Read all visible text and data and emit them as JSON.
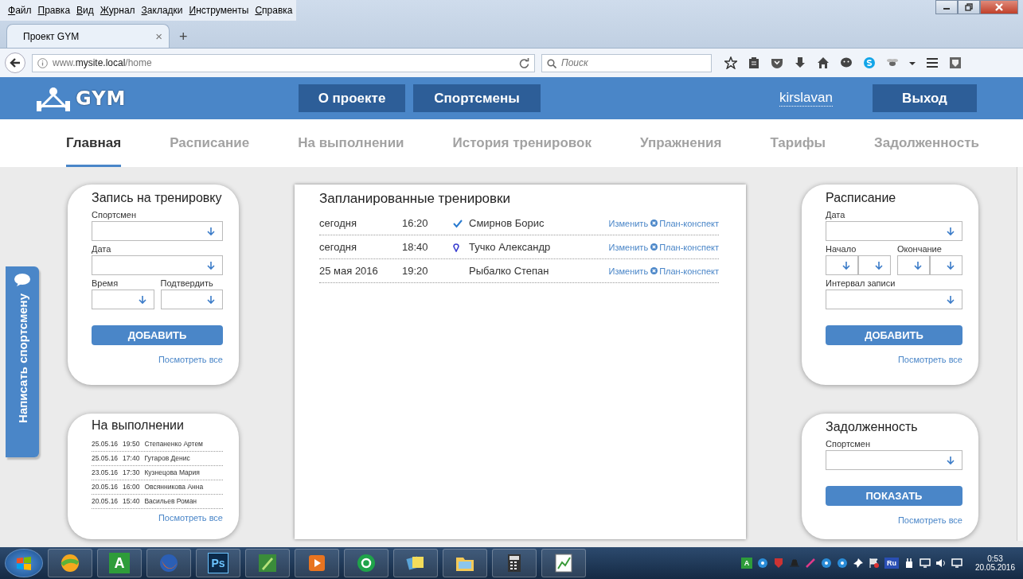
{
  "browser": {
    "menu": [
      "Файл",
      "Правка",
      "Вид",
      "Журнал",
      "Закладки",
      "Инструменты",
      "Справка"
    ],
    "tab": {
      "title": "Проект GYM",
      "close": "×"
    },
    "new_tab": "+",
    "url": "www.**mysite.local**/home",
    "search": {
      "placeholder": "Поиск"
    }
  },
  "header": {
    "logo": "GYM",
    "buttons": [
      "О проекте",
      "Спортсмены"
    ],
    "user": "kirslavan",
    "logout": "Выход"
  },
  "nav": [
    {
      "label": "Главная",
      "selected": true
    },
    {
      "label": "Расписание",
      "selected": false
    },
    {
      "label": "На выполнении",
      "selected": false
    },
    {
      "label": "История тренировок",
      "selected": false
    },
    {
      "label": "Упражнения",
      "selected": false
    },
    {
      "label": "Тарифы",
      "selected": false
    },
    {
      "label": "Задолженность",
      "selected": false
    }
  ],
  "side_tab": {
    "label": "Написать спортсмену"
  },
  "booking": {
    "title": "Запись на тренировку",
    "fields": [
      {
        "kind": "select",
        "label": "Спортсмен"
      },
      {
        "kind": "select",
        "label": "Дата"
      },
      {
        "kind": "half",
        "label": "Время"
      },
      {
        "kind": "half",
        "label": "Подтвердить"
      }
    ],
    "button": "ДОБАВИТЬ",
    "link": "Посмотреть все"
  },
  "in_progress": {
    "title": "На выполнении",
    "rows": [
      {
        "date": "25.05.16",
        "time": "19:50",
        "name": "Степаненко Артем"
      },
      {
        "date": "25.05.16",
        "time": "17:40",
        "name": "Гутаров Денис"
      },
      {
        "date": "23.05.16",
        "time": "17:30",
        "name": "Кузнецова Мария"
      },
      {
        "date": "20.05.16",
        "time": "16:00",
        "name": "Овсянникова Анна"
      },
      {
        "date": "20.05.16",
        "time": "15:40",
        "name": "Васильев Роман"
      }
    ],
    "link": "Посмотреть все"
  },
  "planned": {
    "title": "Запланированные тренировки",
    "rows": [
      {
        "date": "сегодня",
        "time": "16:20",
        "kind": "confirmed",
        "name": "Смирнов Борис",
        "edit": "Изменить",
        "plan": "План-конспект"
      },
      {
        "date": "сегодня",
        "time": "18:40",
        "kind": "pending",
        "name": "Тучко Александр",
        "edit": "Изменить",
        "plan": "План-конспект"
      },
      {
        "date": "25 мая 2016",
        "time": "19:20",
        "kind": "none",
        "name": "Рыбалко Степан",
        "edit": "Изменить",
        "plan": "План-конспект"
      }
    ]
  },
  "schedule": {
    "title": "Расписание",
    "fields": [
      {
        "kind": "select",
        "label": "Дата"
      },
      {
        "kind": "range",
        "label": "Начало"
      },
      {
        "kind": "range",
        "label": "Окончание"
      },
      {
        "kind": "select",
        "label": "Интервал записи"
      }
    ],
    "button": "ДОБАВИТЬ",
    "link": "Посмотреть все"
  },
  "debt": {
    "title": "Задолженность",
    "fields": [
      {
        "kind": "select",
        "label": "Спортсмен"
      }
    ],
    "button": "ПОКАЗАТЬ",
    "link": "Посмотреть все"
  },
  "taskbar": {
    "apps": [
      {
        "kind": "ball"
      },
      {
        "kind": "letter",
        "label": "A",
        "color": "#2e9c3a"
      },
      {
        "kind": "fox"
      },
      {
        "kind": "letter",
        "label": "Ps",
        "color": "#0c2a4a"
      },
      {
        "kind": "pen"
      },
      {
        "kind": "play"
      },
      {
        "kind": "at"
      },
      {
        "kind": "notes"
      },
      {
        "kind": "folder"
      },
      {
        "kind": "calc"
      },
      {
        "kind": "chart"
      }
    ],
    "tray": [
      {
        "kind": "letter",
        "label": "A",
        "color": "#2e9c3a"
      },
      {
        "kind": "disc"
      },
      {
        "kind": "shield"
      },
      {
        "kind": "hat"
      },
      {
        "kind": "pen"
      },
      {
        "kind": "disc"
      },
      {
        "kind": "disc"
      },
      {
        "kind": "pin"
      },
      {
        "kind": "flag"
      },
      {
        "kind": "letter",
        "label": "Ru",
        "color": "#2a4fb5"
      },
      {
        "kind": "plug"
      },
      {
        "kind": "monitor"
      },
      {
        "kind": "speaker"
      },
      {
        "kind": "monitor"
      }
    ],
    "clock": {
      "time": "0:53",
      "date": "20.05.2016"
    }
  }
}
